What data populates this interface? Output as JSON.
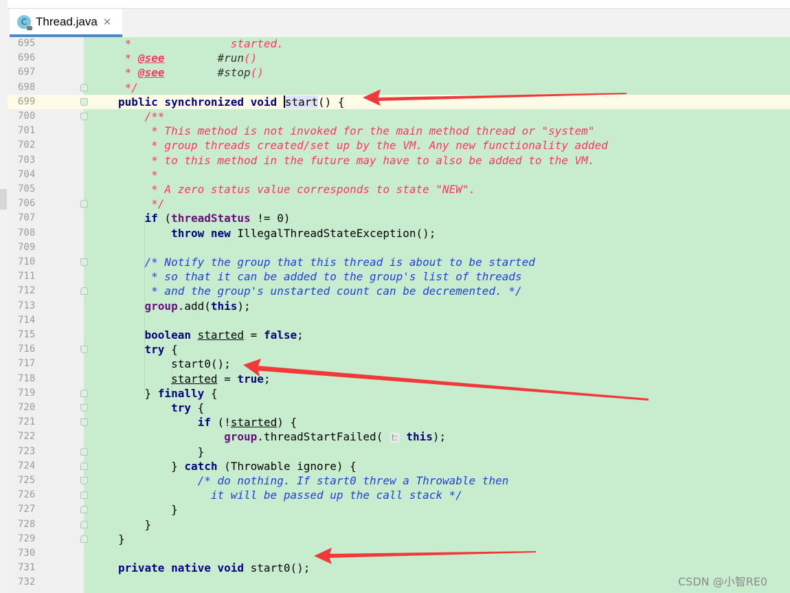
{
  "tab": {
    "icon_letter": "C",
    "filename": "Thread.java",
    "close_glyph": "✕"
  },
  "watermark": "CSDN @小智RE0",
  "colors": {
    "editor_bg": "#c8ecce",
    "keyword": "#000080",
    "field": "#660e7a",
    "doc_comment": "#ff3366",
    "block_comment": "#1f3fe0",
    "arrow": "#f03a3a"
  },
  "icons": {
    "tab_icon": "java-class-icon",
    "close": "close-icon",
    "fold": "fold-marker-icon",
    "arrow": "red-arrow-annotation"
  },
  "caret_line": "699",
  "lines": [
    {
      "n": "695",
      "fold": "",
      "tokens": [
        [
          "cm",
          " *               started."
        ]
      ]
    },
    {
      "n": "696",
      "fold": "",
      "tokens": [
        [
          "cm",
          " * "
        ],
        [
          "tg",
          "@see"
        ],
        [
          "cm",
          "        "
        ],
        [
          "ref",
          "#run"
        ],
        [
          "cm",
          "()"
        ]
      ]
    },
    {
      "n": "697",
      "fold": "",
      "tokens": [
        [
          "cm",
          " * "
        ],
        [
          "tg",
          "@see"
        ],
        [
          "cm",
          "        "
        ],
        [
          "ref",
          "#stop"
        ],
        [
          "cm",
          "()"
        ]
      ]
    },
    {
      "n": "698",
      "fold": "up",
      "tokens": [
        [
          "cm",
          " */"
        ]
      ]
    },
    {
      "n": "699",
      "fold": "down",
      "tokens": [
        [
          "kw",
          "public synchronized void "
        ],
        [
          "caret",
          ""
        ],
        [
          "sel",
          "start"
        ],
        [
          "p",
          "() {"
        ]
      ]
    },
    {
      "n": "700",
      "fold": "down",
      "tokens": [
        [
          "cm",
          "    /**"
        ]
      ]
    },
    {
      "n": "701",
      "fold": "",
      "tokens": [
        [
          "cm",
          "     * This method is not invoked for the main method thread or \"system\""
        ]
      ]
    },
    {
      "n": "702",
      "fold": "",
      "tokens": [
        [
          "cm",
          "     * group threads created/set up by the VM. Any new functionality added"
        ]
      ]
    },
    {
      "n": "703",
      "fold": "",
      "tokens": [
        [
          "cm",
          "     * to this method in the future may have to also be added to the VM."
        ]
      ]
    },
    {
      "n": "704",
      "fold": "",
      "tokens": [
        [
          "cm",
          "     *"
        ]
      ]
    },
    {
      "n": "705",
      "fold": "",
      "tokens": [
        [
          "cm",
          "     * A zero status value corresponds to state \"NEW\"."
        ]
      ]
    },
    {
      "n": "706",
      "fold": "up",
      "tokens": [
        [
          "cm",
          "     */"
        ]
      ]
    },
    {
      "n": "707",
      "fold": "",
      "tokens": [
        [
          "p",
          "    "
        ],
        [
          "kw",
          "if"
        ],
        [
          "p",
          " ("
        ],
        [
          "fld",
          "threadStatus"
        ],
        [
          "p",
          " != 0)"
        ]
      ]
    },
    {
      "n": "708",
      "fold": "",
      "tokens": [
        [
          "p",
          "        "
        ],
        [
          "kw",
          "throw new"
        ],
        [
          "p",
          " IllegalThreadStateException();"
        ]
      ]
    },
    {
      "n": "709",
      "fold": "",
      "tokens": []
    },
    {
      "n": "710",
      "fold": "down",
      "tokens": [
        [
          "cb",
          "    /* Notify the group that this thread is about to be started"
        ]
      ]
    },
    {
      "n": "711",
      "fold": "",
      "tokens": [
        [
          "cb",
          "     * so that it can be added to the group's list of threads"
        ]
      ]
    },
    {
      "n": "712",
      "fold": "up",
      "tokens": [
        [
          "cb",
          "     * and the group's unstarted count can be decremented. */"
        ]
      ]
    },
    {
      "n": "713",
      "fold": "",
      "tokens": [
        [
          "p",
          "    "
        ],
        [
          "fld",
          "group"
        ],
        [
          "p",
          ".add("
        ],
        [
          "kw",
          "this"
        ],
        [
          "p",
          ");"
        ]
      ]
    },
    {
      "n": "714",
      "fold": "",
      "tokens": []
    },
    {
      "n": "715",
      "fold": "",
      "tokens": [
        [
          "p",
          "    "
        ],
        [
          "kw",
          "boolean"
        ],
        [
          "p",
          " "
        ],
        [
          "ul",
          "started"
        ],
        [
          "p",
          " = "
        ],
        [
          "kw",
          "false"
        ],
        [
          "p",
          ";"
        ]
      ]
    },
    {
      "n": "716",
      "fold": "down",
      "tokens": [
        [
          "p",
          "    "
        ],
        [
          "kw",
          "try"
        ],
        [
          "p",
          " {"
        ]
      ]
    },
    {
      "n": "717",
      "fold": "",
      "tokens": [
        [
          "p",
          "        start0();"
        ]
      ]
    },
    {
      "n": "718",
      "fold": "",
      "tokens": [
        [
          "p",
          "        "
        ],
        [
          "ul",
          "started"
        ],
        [
          "p",
          " = "
        ],
        [
          "kw",
          "true"
        ],
        [
          "p",
          ";"
        ]
      ]
    },
    {
      "n": "719",
      "fold": "up",
      "tokens": [
        [
          "p",
          "    } "
        ],
        [
          "kw",
          "finally"
        ],
        [
          "p",
          " {"
        ]
      ]
    },
    {
      "n": "720",
      "fold": "down",
      "tokens": [
        [
          "p",
          "        "
        ],
        [
          "kw",
          "try"
        ],
        [
          "p",
          " {"
        ]
      ]
    },
    {
      "n": "721",
      "fold": "down",
      "tokens": [
        [
          "p",
          "            "
        ],
        [
          "kw",
          "if"
        ],
        [
          "p",
          " (!"
        ],
        [
          "ul",
          "started"
        ],
        [
          "p",
          ") {"
        ]
      ]
    },
    {
      "n": "722",
      "fold": "",
      "tokens": [
        [
          "p",
          "                "
        ],
        [
          "fld",
          "group"
        ],
        [
          "p",
          ".threadStartFailed( "
        ],
        [
          "hint",
          "t:"
        ],
        [
          "p",
          " "
        ],
        [
          "kw",
          "this"
        ],
        [
          "p",
          ");"
        ]
      ]
    },
    {
      "n": "723",
      "fold": "up",
      "tokens": [
        [
          "p",
          "            }"
        ]
      ]
    },
    {
      "n": "724",
      "fold": "up",
      "tokens": [
        [
          "p",
          "        } "
        ],
        [
          "kw",
          "catch"
        ],
        [
          "p",
          " (Throwable ignore) {"
        ]
      ]
    },
    {
      "n": "725",
      "fold": "down",
      "tokens": [
        [
          "cb",
          "            /* do nothing. If start0 threw a Throwable then"
        ]
      ]
    },
    {
      "n": "726",
      "fold": "up",
      "tokens": [
        [
          "cb",
          "              it will be passed up the call stack */"
        ]
      ]
    },
    {
      "n": "727",
      "fold": "up",
      "tokens": [
        [
          "p",
          "        }"
        ]
      ]
    },
    {
      "n": "728",
      "fold": "up",
      "tokens": [
        [
          "p",
          "    }"
        ]
      ]
    },
    {
      "n": "729",
      "fold": "up",
      "tokens": [
        [
          "p",
          "}"
        ]
      ]
    },
    {
      "n": "730",
      "fold": "",
      "tokens": []
    },
    {
      "n": "731",
      "fold": "",
      "tokens": [
        [
          "kw",
          "private native void"
        ],
        [
          "p",
          " start0();"
        ]
      ]
    },
    {
      "n": "732",
      "fold": "",
      "tokens": []
    }
  ]
}
